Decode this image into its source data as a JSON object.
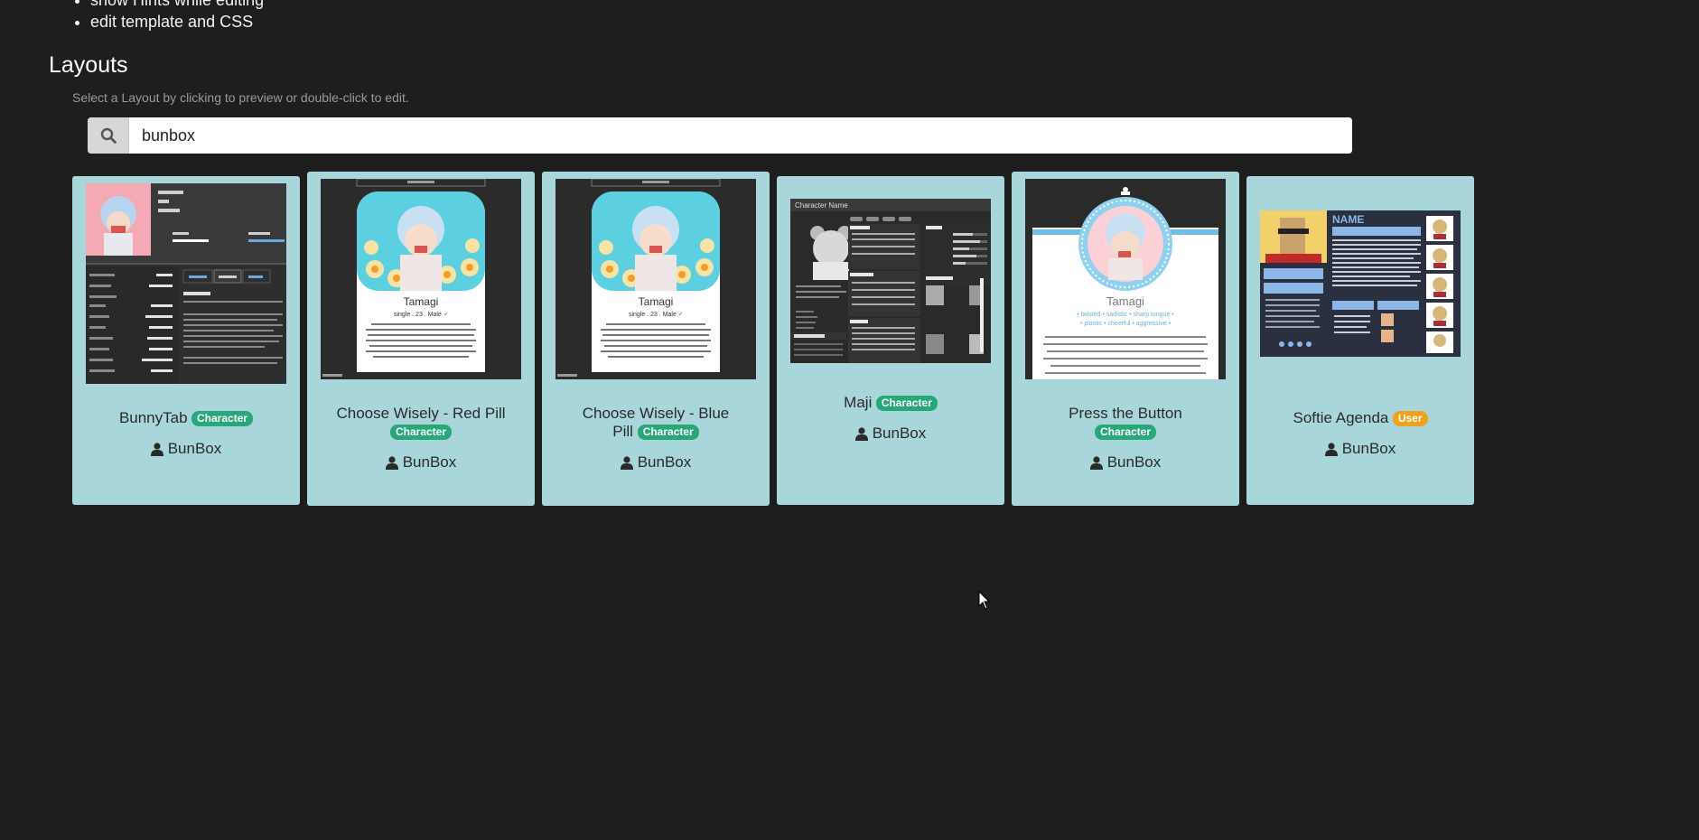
{
  "features": [
    "show Hints while editing",
    "edit template and CSS"
  ],
  "section": {
    "title": "Layouts",
    "hint": "Select a Layout by clicking to preview or double-click to edit."
  },
  "search": {
    "value": "bunbox",
    "icon": "search-icon"
  },
  "cards": [
    {
      "name": "BunnyTab",
      "badge": "Character",
      "author": "BunBox",
      "thumb": {
        "profile_name": "Tagami",
        "age": "23",
        "gender": "Male ♂",
        "status_label": "Status",
        "status_value": "forever horned",
        "designer_label": "Designer",
        "designer_value": "bunboxstyles",
        "tabs": [
          "PHOTOS",
          "ABOUT",
          "LINKS"
        ],
        "about_heading": "ABOUT",
        "about_tags": "Twisted | Sadistic | Sharp Tongue | Plastic | Cheerful",
        "fields": [
          {
            "k": "Looking For",
            "v": "men"
          },
          {
            "k": "Lifestyle Expectation",
            "v": "practical"
          },
          {
            "k": "Height",
            "v": "5'8 (178cm)"
          },
          {
            "k": "Body Type",
            "v": "slim/average"
          },
          {
            "k": "Race",
            "v": "usagimimi"
          },
          {
            "k": "Hair Color",
            "v": "iceberg blue"
          },
          {
            "k": "Eye Color",
            "v": "picton blue"
          },
          {
            "k": "Education",
            "v": "bachelors degree"
          },
          {
            "k": "Occupation",
            "v": "80's mascot"
          },
          {
            "k": "Relationship",
            "v": "single"
          }
        ]
      }
    },
    {
      "name": "Choose Wisely - Red Pill",
      "badge": "Character",
      "author": "BunBox",
      "thumb": {
        "top_label": "Get Code",
        "name": "Tamagi",
        "sub": "single . 23 . Male ♂",
        "footer": "imgflip.com"
      }
    },
    {
      "name": "Choose Wisely - Blue Pill",
      "badge": "Character",
      "author": "BunBox",
      "thumb": {
        "top_label": "Get Code",
        "name": "Tamagi",
        "sub": "single . 23 . Male ♂",
        "footer": "imgflip.com"
      }
    },
    {
      "name": "Maji",
      "badge": "Character",
      "author": "BunBox",
      "thumb": {
        "header": "Character Name",
        "sections": [
          "Trivia",
          "Stats",
          "Interests",
          "Relationships",
          "Personality",
          "About"
        ]
      }
    },
    {
      "name": "Press the Button",
      "badge": "Character",
      "author": "BunBox",
      "thumb": {
        "name": "Tamagi",
        "tags1": "• twisted • sadistic • sharp tongue •",
        "tags2": "• plastic • cheerful • aggressive •"
      }
    },
    {
      "name": "Softie Agenda",
      "badge": "User",
      "author": "BunBox",
      "thumb": {
        "heading": "NAME",
        "tabs": [
          "ABOUT",
          "INTERESTS",
          "FRIENDS"
        ]
      }
    }
  ],
  "colors": {
    "background": "#1e1e1e",
    "card": "#a9d6db",
    "badge_character": "#27a77a",
    "badge_user": "#f0a21a"
  }
}
